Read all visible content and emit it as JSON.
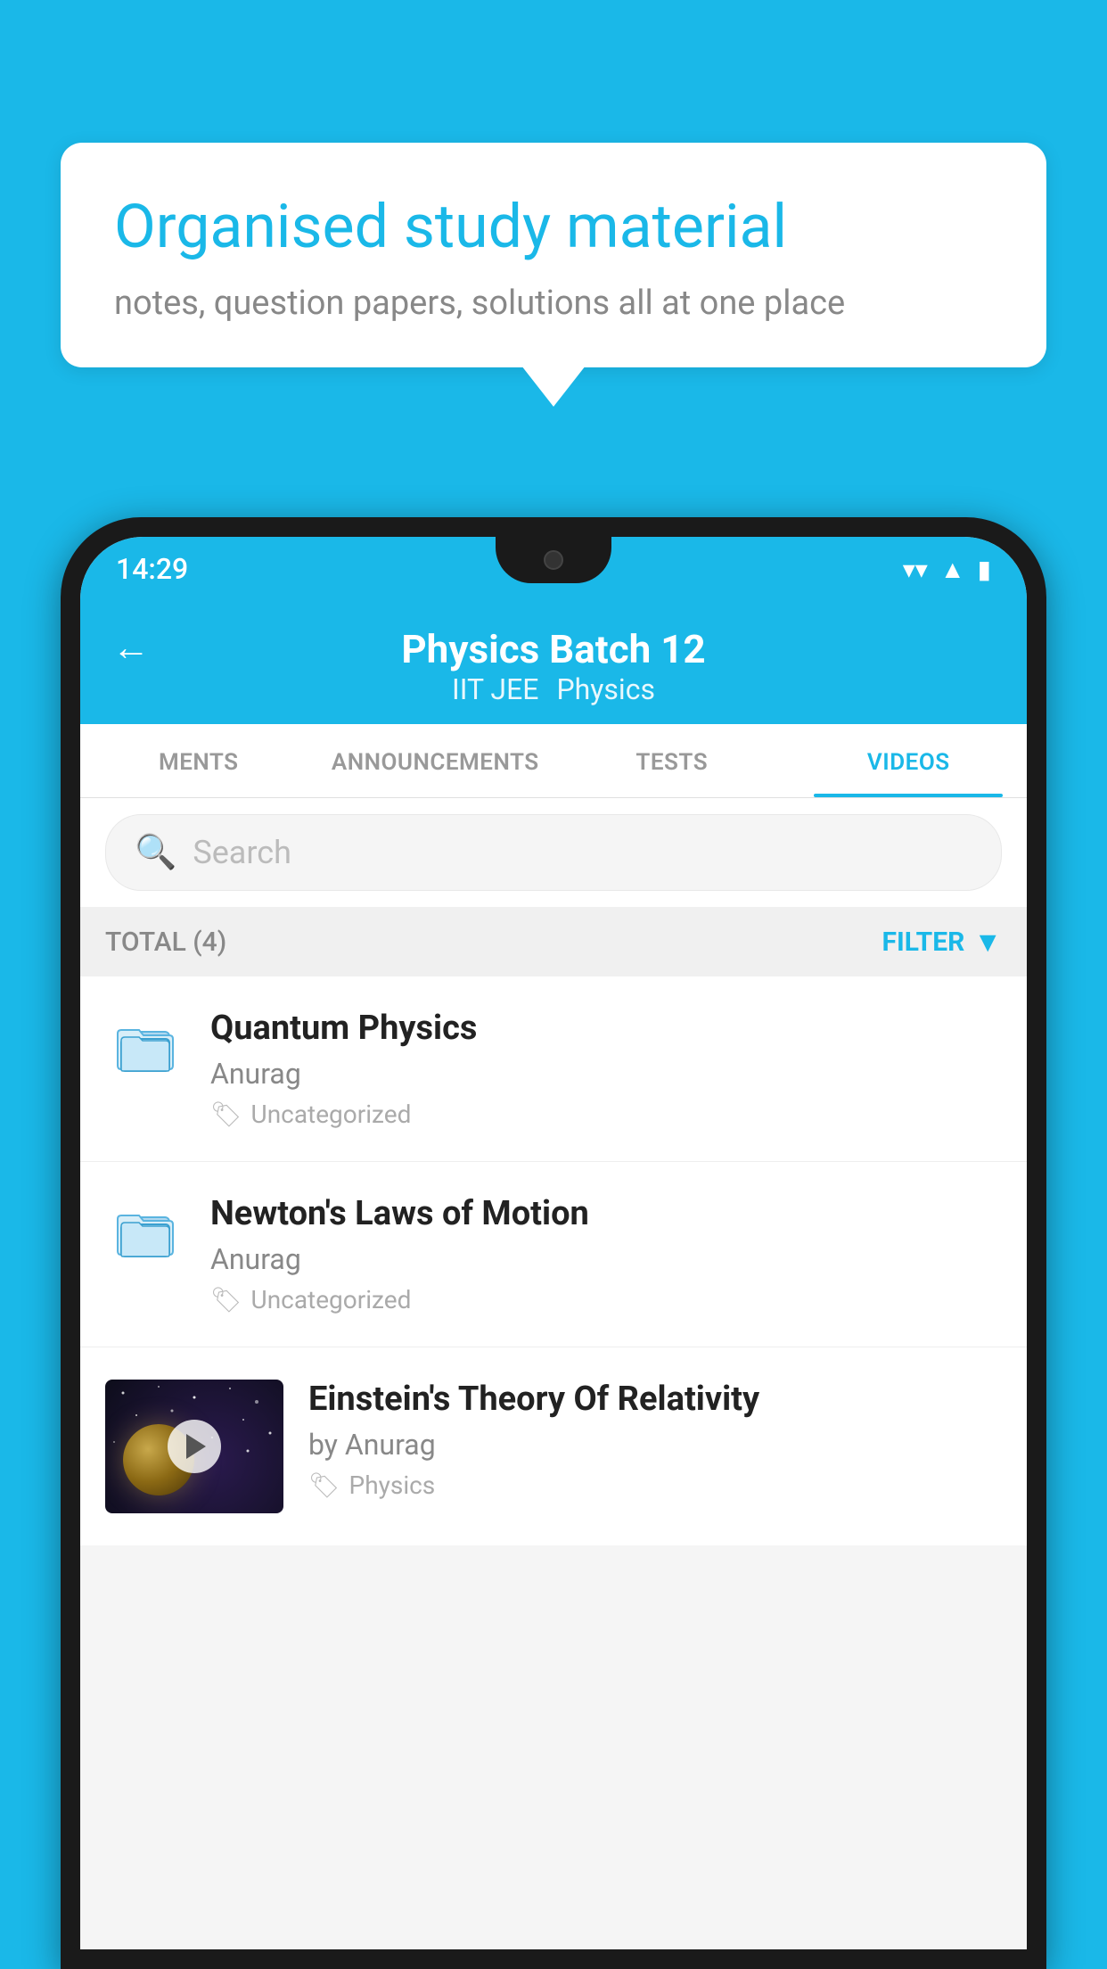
{
  "background_color": "#1ab8e8",
  "bubble": {
    "title": "Organised study material",
    "subtitle": "notes, question papers, solutions all at one place"
  },
  "phone": {
    "status_bar": {
      "time": "14:29",
      "icons": [
        "wifi",
        "signal",
        "battery"
      ]
    },
    "header": {
      "back_label": "←",
      "title": "Physics Batch 12",
      "subtitle_tag1": "IIT JEE",
      "subtitle_tag2": "Physics"
    },
    "tabs": [
      {
        "label": "MENTS",
        "active": false
      },
      {
        "label": "ANNOUNCEMENTS",
        "active": false
      },
      {
        "label": "TESTS",
        "active": false
      },
      {
        "label": "VIDEOS",
        "active": true
      }
    ],
    "search": {
      "placeholder": "Search"
    },
    "filter_bar": {
      "total": "TOTAL (4)",
      "filter_label": "FILTER"
    },
    "videos": [
      {
        "title": "Quantum Physics",
        "author": "Anurag",
        "tag": "Uncategorized",
        "has_thumb": false
      },
      {
        "title": "Newton's Laws of Motion",
        "author": "Anurag",
        "tag": "Uncategorized",
        "has_thumb": false
      },
      {
        "title": "Einstein's Theory Of Relativity",
        "author": "by Anurag",
        "tag": "Physics",
        "has_thumb": true
      }
    ]
  }
}
